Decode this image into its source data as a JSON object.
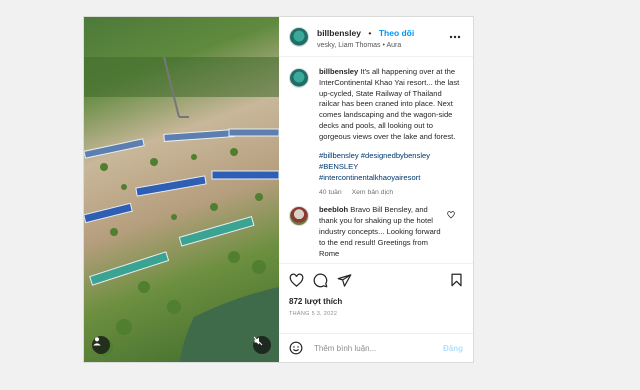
{
  "post": {
    "username": "billbensley",
    "separator": "•",
    "follow_label": "Theo dõi",
    "audio_line": "vesky, Liam Thomas • Aura"
  },
  "caption": {
    "username": "billbensley",
    "text": "It's all happening over at the InterContinental Khao Yai resort... the last up-cycled, State Railway of Thailand railcar has been craned into place. Next comes landscaping and the wagon-side decks and pools, all looking out to gorgeous views over the lake and forest.",
    "hashtags": [
      "#billbensley #designedbybensley",
      "#BENSLEY",
      "#intercontinentalkhaoyairesort"
    ],
    "time": "40 tuần",
    "translate": "Xem bản dịch"
  },
  "comment": {
    "username": "beebloh",
    "text": "Bravo Bill Bensley, and thank you for shaking up the hotel industry concepts... Looking forward to the end result! Greetings from Rome"
  },
  "likes": "872 lượt thích",
  "date": "THÁNG 5 3, 2022",
  "add_comment": {
    "placeholder": "Thêm bình luận...",
    "post_label": "Đăng"
  },
  "icons": {
    "more": "more-options-icon",
    "like": "heart-icon",
    "comment": "comment-icon",
    "share": "share-icon",
    "save": "bookmark-icon",
    "emoji": "emoji-icon",
    "user_tag": "user-tag-icon",
    "mute": "muted-icon"
  },
  "colors": {
    "accent": "#0095f6",
    "hashtag": "#00376b",
    "post_disabled": "#b2dffc"
  }
}
